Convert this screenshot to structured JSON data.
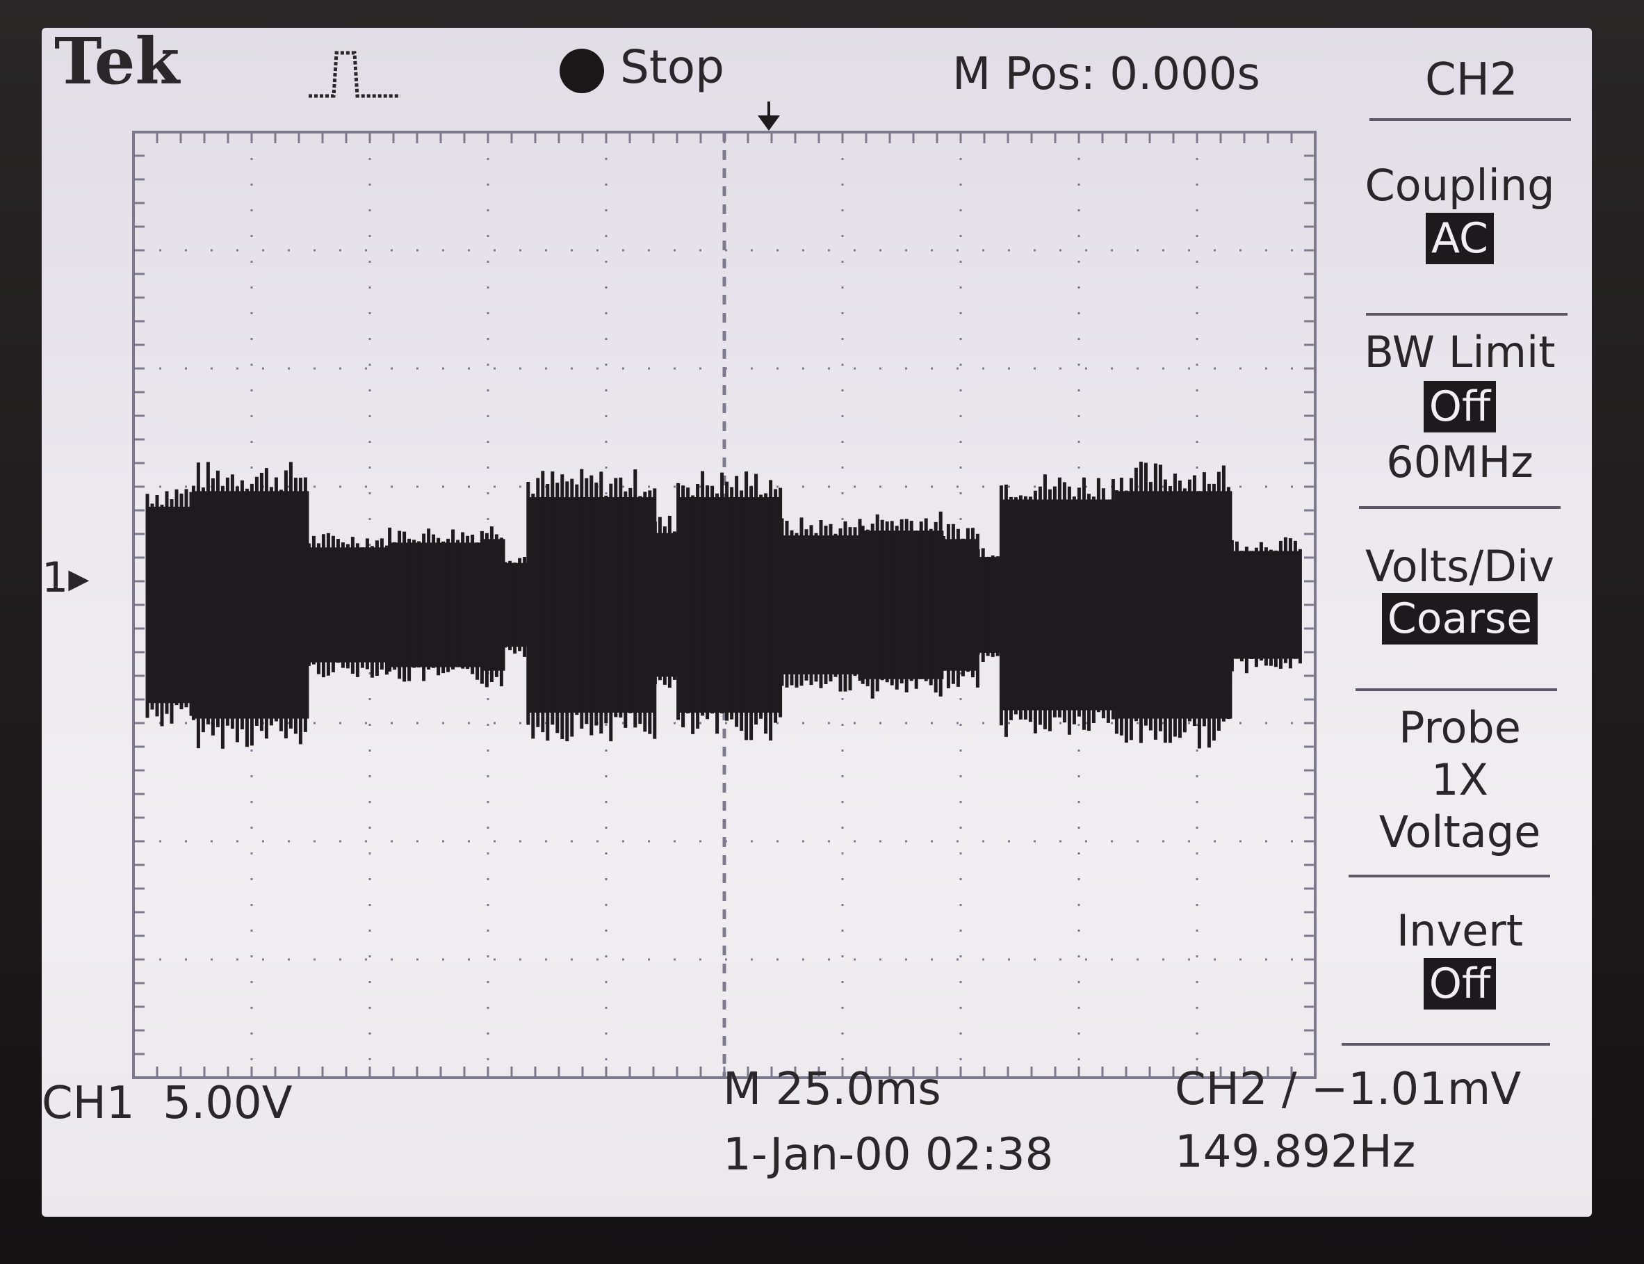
{
  "header": {
    "brand": "Tek",
    "status": "Stop",
    "m_pos": "M Pos: 0.000s"
  },
  "menu": {
    "channel": "CH2",
    "coupling_label": "Coupling",
    "coupling_value": "AC",
    "bw_label": "BW Limit",
    "bw_value": "Off",
    "bw_freq": "60MHz",
    "vdiv_label": "Volts/Div",
    "vdiv_value": "Coarse",
    "probe_label": "Probe",
    "probe_atten": "1X",
    "probe_type": "Voltage",
    "invert_label": "Invert",
    "invert_value": "Off"
  },
  "footer": {
    "ch1_scale": "CH1  5.00V",
    "timebase": "M 25.0ms",
    "datetime": "1-Jan-00 02:38",
    "trigger": "CH2 ∕ −1.01mV",
    "frequency": "149.892Hz"
  },
  "marker": {
    "ch1": "1"
  },
  "colors": {
    "trace": "#1e1a1d",
    "background": "#ebe7ec",
    "grid": "#7c7a8c"
  },
  "waveform": {
    "description_free": true,
    "segments": [
      [
        0.0,
        0.04,
        0.82
      ],
      [
        0.04,
        0.14,
        0.95
      ],
      [
        0.14,
        0.21,
        0.48
      ],
      [
        0.21,
        0.29,
        0.52
      ],
      [
        0.29,
        0.31,
        0.55
      ],
      [
        0.31,
        0.33,
        0.35
      ],
      [
        0.33,
        0.44,
        0.9
      ],
      [
        0.44,
        0.46,
        0.6
      ],
      [
        0.46,
        0.55,
        0.9
      ],
      [
        0.55,
        0.62,
        0.58
      ],
      [
        0.62,
        0.69,
        0.62
      ],
      [
        0.69,
        0.72,
        0.55
      ],
      [
        0.72,
        0.74,
        0.4
      ],
      [
        0.74,
        0.84,
        0.88
      ],
      [
        0.84,
        0.94,
        0.95
      ],
      [
        0.94,
        1.0,
        0.45
      ]
    ]
  }
}
